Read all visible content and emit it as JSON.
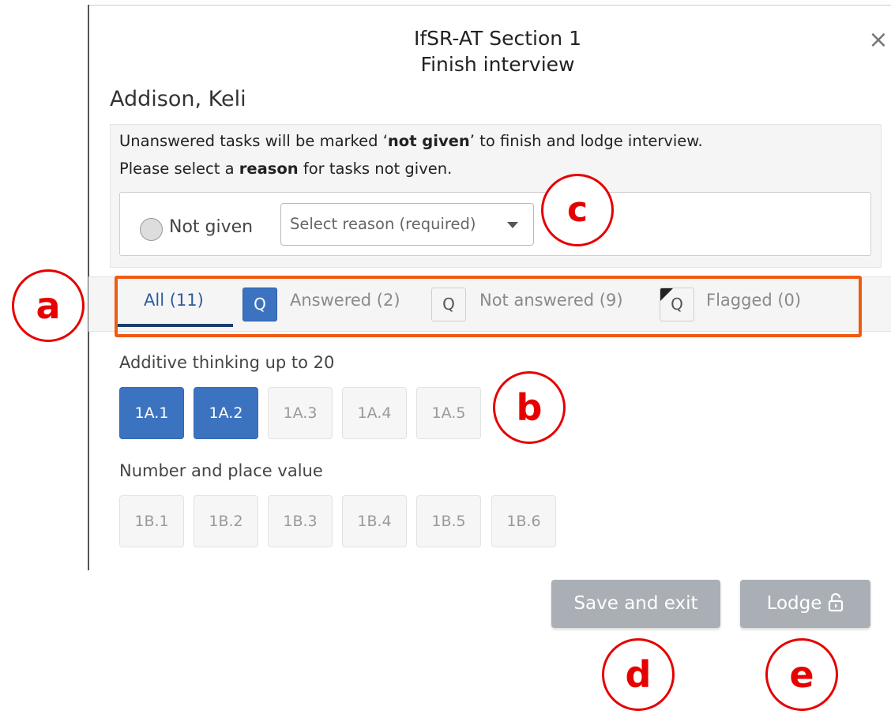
{
  "modal": {
    "title_line1": "IfSR-AT Section 1",
    "title_line2": "Finish interview",
    "close_glyph": "×"
  },
  "student_name": "Addison, Keli",
  "notice": {
    "line1_prefix": "Unanswered tasks will be marked ‘",
    "line1_bold": "not given",
    "line1_suffix": "’ to finish and lodge interview.",
    "line2_prefix": "Please select a ",
    "line2_bold": "reason",
    "line2_suffix": " for tasks not given."
  },
  "reason": {
    "radio_label": "Not given",
    "select_placeholder": "Select reason (required)"
  },
  "tabs": {
    "all": "All (11)",
    "answered": "Answered (2)",
    "not_answered": "Not answered (9)",
    "flagged": "Flagged (0)",
    "q_glyph": "Q"
  },
  "sections": [
    {
      "heading": "Additive thinking up to 20",
      "tasks": [
        {
          "label": "1A.1",
          "status": "answered"
        },
        {
          "label": "1A.2",
          "status": "answered"
        },
        {
          "label": "1A.3",
          "status": "not-answered"
        },
        {
          "label": "1A.4",
          "status": "not-answered"
        },
        {
          "label": "1A.5",
          "status": "not-answered"
        }
      ]
    },
    {
      "heading": "Number and place value",
      "tasks": [
        {
          "label": "1B.1",
          "status": "not-answered"
        },
        {
          "label": "1B.2",
          "status": "not-answered"
        },
        {
          "label": "1B.3",
          "status": "not-answered"
        },
        {
          "label": "1B.4",
          "status": "not-answered"
        },
        {
          "label": "1B.5",
          "status": "not-answered"
        },
        {
          "label": "1B.6",
          "status": "not-answered"
        }
      ]
    }
  ],
  "buttons": {
    "save_exit": "Save and exit",
    "lodge": "Lodge"
  },
  "callouts": {
    "a": "a",
    "b": "b",
    "c": "c",
    "d": "d",
    "e": "e"
  },
  "colors": {
    "accent_blue": "#3b73c1",
    "tab_active_text": "#2d5b9c",
    "highlight_orange": "#f05a12",
    "callout_red": "#e60000",
    "button_gray": "#a9afb5"
  }
}
